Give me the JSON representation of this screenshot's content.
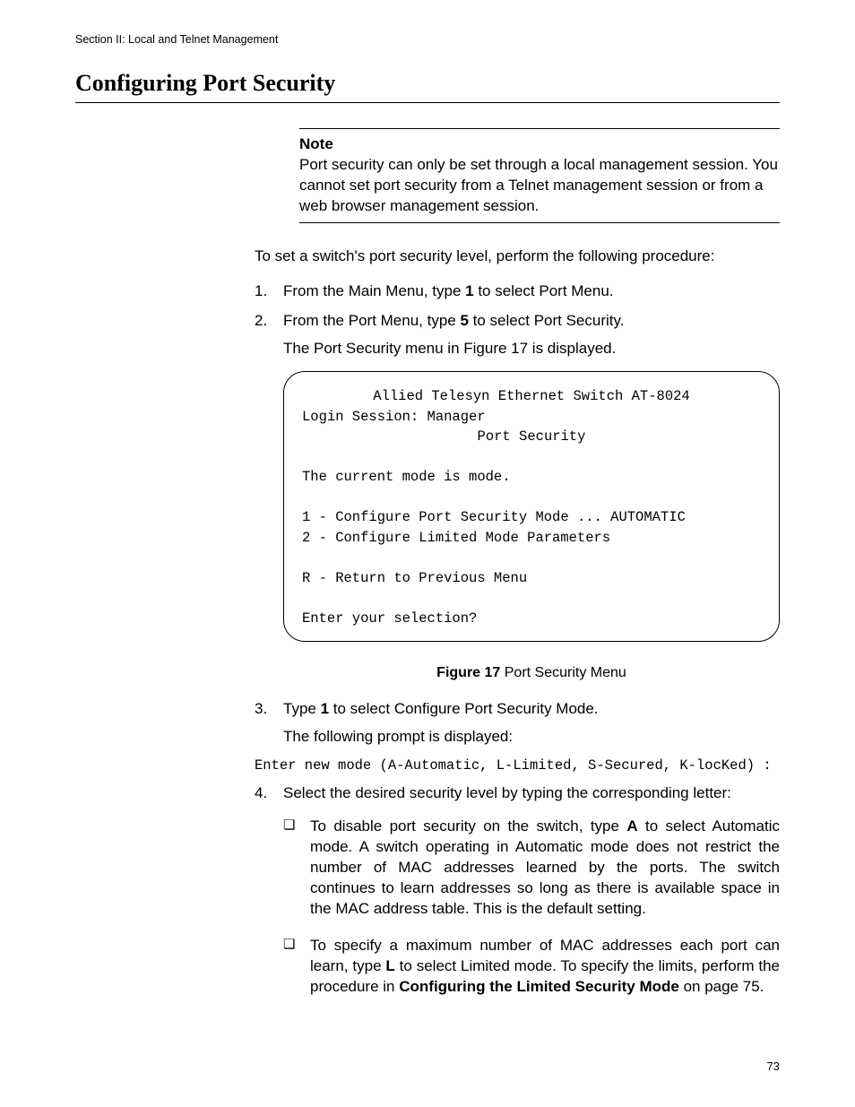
{
  "header": {
    "running": "Section II: Local and Telnet Management"
  },
  "title": "Configuring Port Security",
  "note": {
    "heading": "Note",
    "body": "Port security can only be set through a local management session. You cannot set port security from a Telnet management session or from a web browser management session."
  },
  "intro": "To set a switch's port security level, perform the following procedure:",
  "steps": {
    "s1_a": "From the Main Menu, type ",
    "s1_b": "1",
    "s1_c": " to select Port Menu.",
    "s2_a": "From the Port Menu, type ",
    "s2_b": "5",
    "s2_c": " to select Port Security.",
    "s2_cont": "The Port Security menu in Figure 17 is displayed.",
    "s3_a": "Type ",
    "s3_b": "1",
    "s3_c": " to select Configure Port Security Mode.",
    "s3_cont": "The following prompt is displayed:",
    "s4": "Select the desired security level by typing the corresponding letter:"
  },
  "terminal": {
    "title": "Allied Telesyn Ethernet Switch AT-8024",
    "login": "Login Session: Manager",
    "subtitle": "Port Security",
    "status": "The current mode is mode.",
    "opt1": "1 - Configure Port Security Mode ... AUTOMATIC",
    "opt2": "2 - Configure Limited Mode Parameters",
    "optR": "R - Return to Previous Menu",
    "prompt": "Enter your selection?"
  },
  "figure": {
    "label": "Figure 17",
    "caption": "  Port Security Menu"
  },
  "code_prompt": "Enter new mode (A-Automatic, L-Limited, S-Secured, K-locKed) :",
  "bullets": {
    "b1_a": "To disable port security on the switch, type ",
    "b1_b": "A",
    "b1_c": " to select Automatic mode. A switch operating in Automatic mode does not restrict the number of MAC addresses learned by the ports. The switch continues to learn addresses so long as there is available space in the MAC address table. This is the default setting.",
    "b2_a": "To specify a maximum number of MAC addresses each port can learn, type ",
    "b2_b": "L",
    "b2_c": " to select Limited mode. To specify the limits, perform the procedure in ",
    "b2_d": "Configuring the Limited Security Mode",
    "b2_e": " on page 75."
  },
  "page_number": "73"
}
